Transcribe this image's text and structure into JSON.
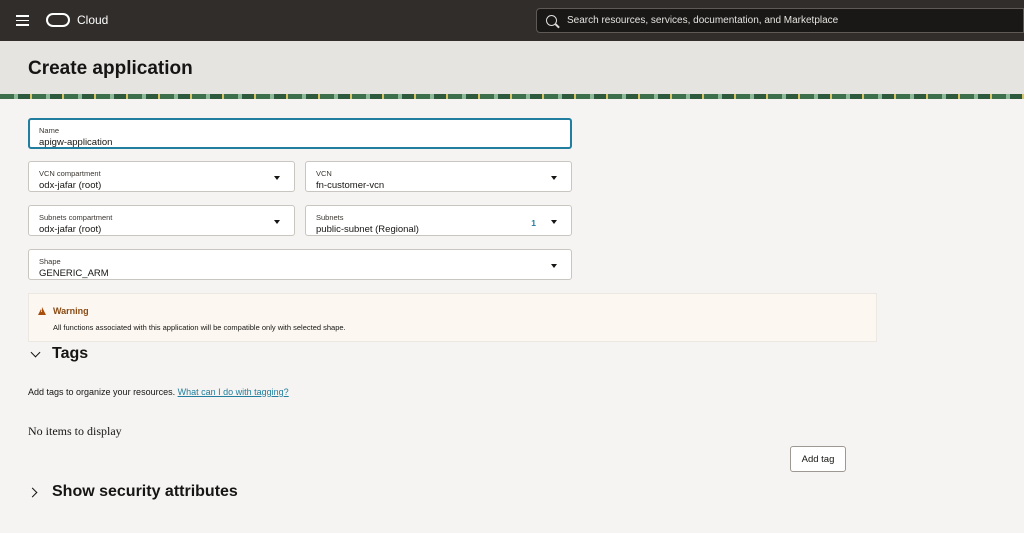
{
  "topbar": {
    "brand": "Cloud",
    "search_placeholder": "Search resources, services, documentation, and Marketplace"
  },
  "page": {
    "title": "Create application"
  },
  "form": {
    "name": {
      "label": "Name",
      "value": "apigw-application"
    },
    "vcn_compartment": {
      "label": "VCN compartment",
      "value": "odx-jafar (root)"
    },
    "vcn": {
      "label": "VCN",
      "value": "fn-customer-vcn"
    },
    "subnets_compartment": {
      "label": "Subnets compartment",
      "value": "odx-jafar (root)"
    },
    "subnets": {
      "label": "Subnets",
      "value": "public-subnet (Regional)",
      "count": "1"
    },
    "shape": {
      "label": "Shape",
      "value": "GENERIC_ARM"
    }
  },
  "warning": {
    "title": "Warning",
    "text": "All functions associated with this application will be compatible only with selected shape."
  },
  "tags": {
    "title": "Tags",
    "description": "Add tags to organize your resources.",
    "link": "What can I do with tagging?",
    "empty": "No items to display",
    "add_button": "Add tag"
  },
  "security": {
    "title": "Show security attributes"
  },
  "icons": {
    "menu": "hamburger-menu-icon",
    "logo": "oracle-logo-icon",
    "search": "search-icon",
    "dropdown": "caret-down-icon",
    "warning": "warning-triangle-icon",
    "expand": "chevron-icon"
  },
  "colors": {
    "topbar": "#312d2a",
    "header": "#e6e4e1",
    "accent": "#227e9e",
    "warning": "#a84e0d"
  }
}
